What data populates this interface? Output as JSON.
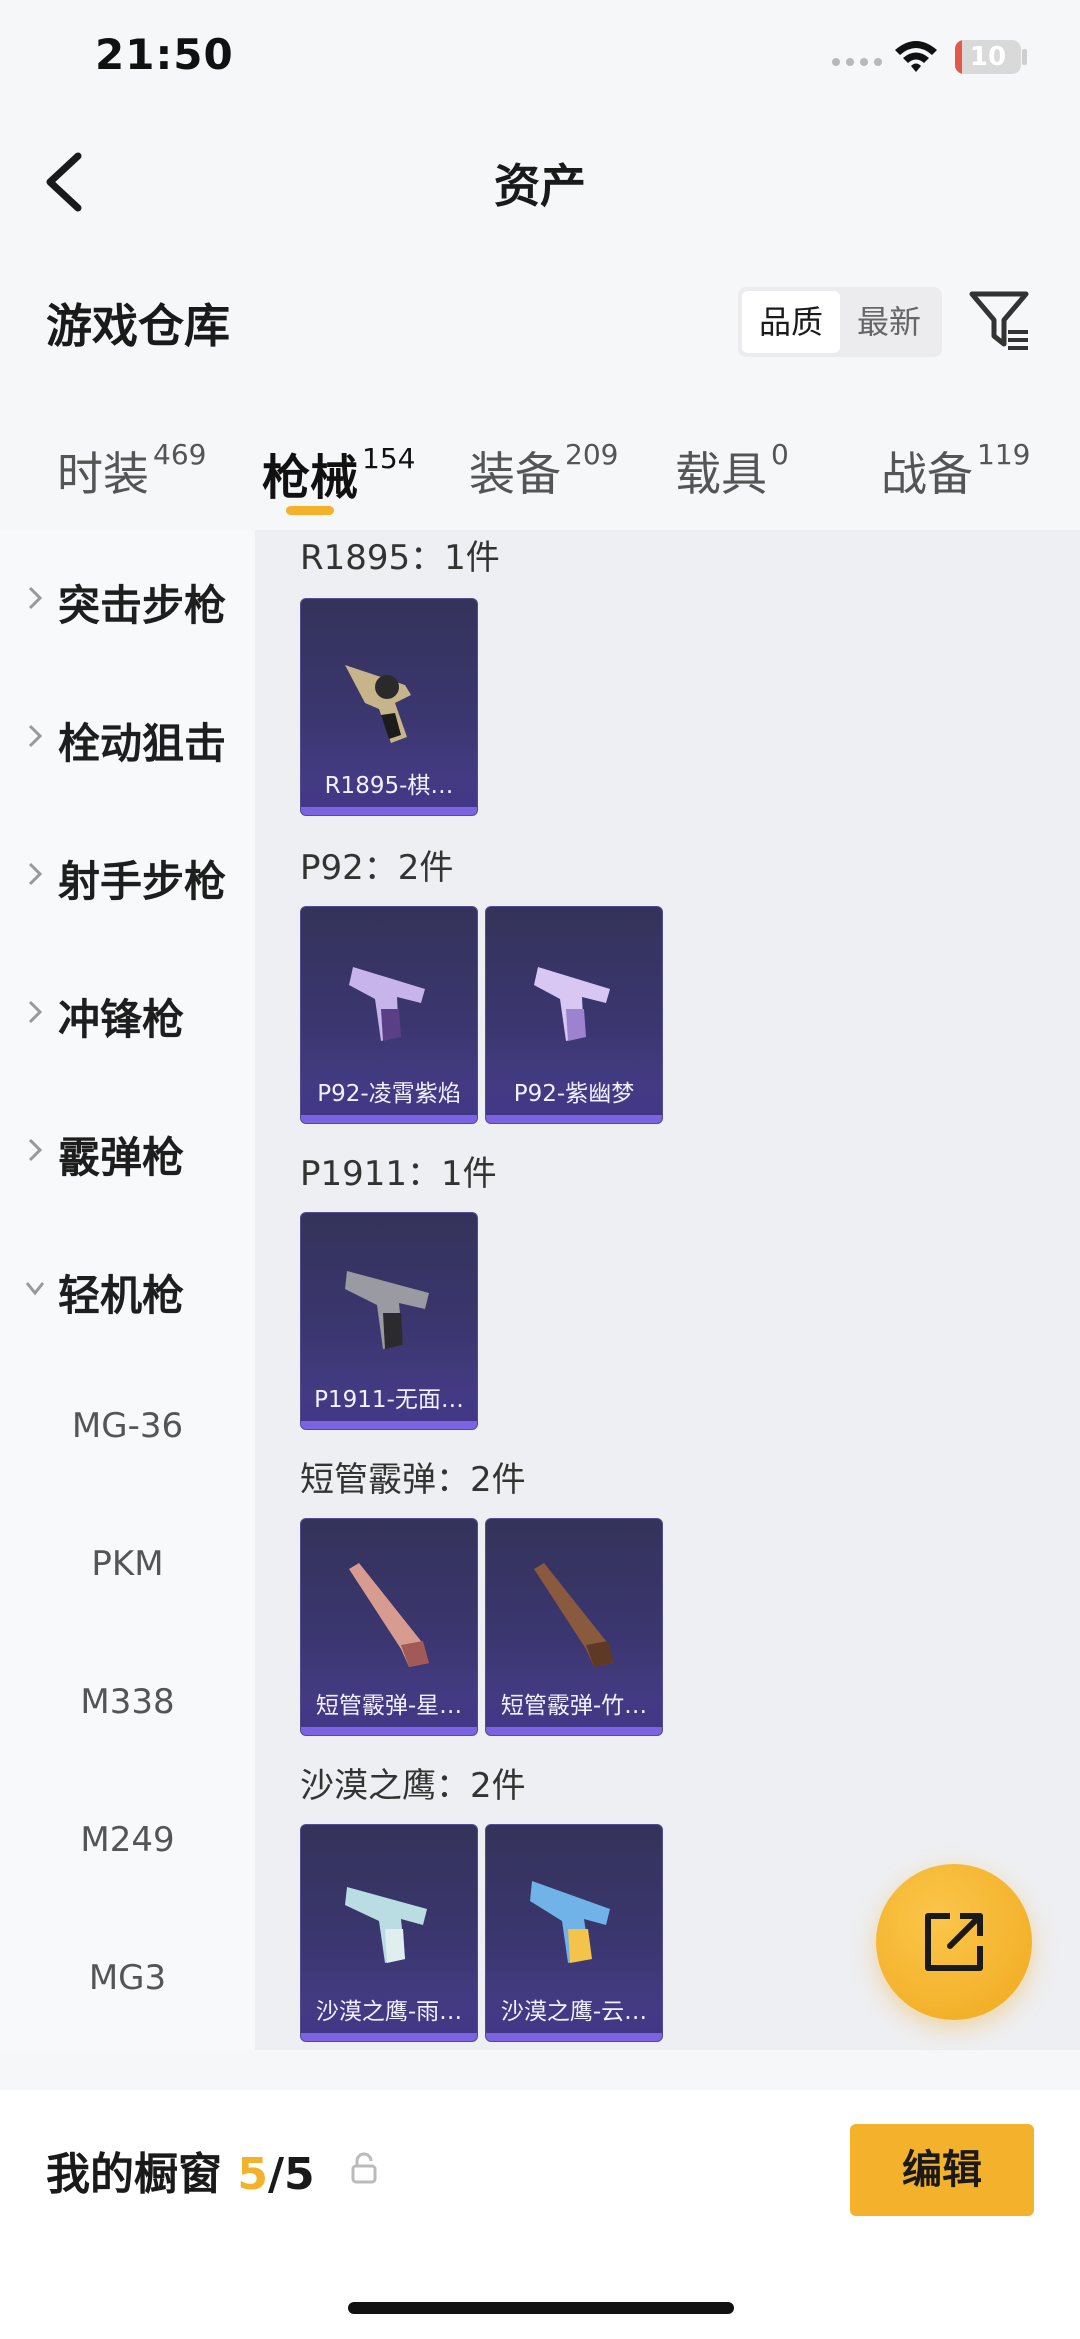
{
  "status_bar": {
    "time": "21:50",
    "battery": "10",
    "battery_level": 0.1
  },
  "header": {
    "title": "资产"
  },
  "warehouse": {
    "title": "游戏仓库",
    "sort": [
      "品质",
      "最新"
    ],
    "sort_selected": "品质"
  },
  "tabs": [
    {
      "label": "时装",
      "count": "469"
    },
    {
      "label": "枪械",
      "count": "154"
    },
    {
      "label": "装备",
      "count": "209"
    },
    {
      "label": "载具",
      "count": "0"
    },
    {
      "label": "战备",
      "count": "119"
    }
  ],
  "active_tab": "枪械",
  "sidebar": {
    "categories": [
      "突击步枪",
      "栓动狙击",
      "射手步枪",
      "冲锋枪",
      "霰弹枪",
      "轻机枪"
    ],
    "expanded": "轻机枪",
    "subitems": [
      "MG-36",
      "PKM",
      "M338",
      "M249",
      "MG3"
    ]
  },
  "groups": [
    {
      "title": "R1895：1件",
      "items": [
        "R1895-棋…"
      ]
    },
    {
      "title": "P92：2件",
      "items": [
        "P92-凌霄紫焰",
        "P92-紫幽梦"
      ]
    },
    {
      "title": "P1911：1件",
      "items": [
        "P1911-无面…"
      ]
    },
    {
      "title": "短管霰弹：2件",
      "items": [
        "短管霰弹-星…",
        "短管霰弹-竹…"
      ]
    },
    {
      "title": "沙漠之鹰：2件",
      "items": [
        "沙漠之鹰-雨…",
        "沙漠之鹰-云…"
      ]
    }
  ],
  "showcase": {
    "label": "我的橱窗",
    "current": "5",
    "total": "/5"
  },
  "edit_button": "编辑",
  "colors": {
    "accent": "#f3b12c",
    "card_purple": "#3b3670"
  },
  "icons": [
    "back-icon",
    "filter-icon",
    "chevron-right-icon",
    "chevron-down-icon",
    "share-icon",
    "lock-icon"
  ]
}
